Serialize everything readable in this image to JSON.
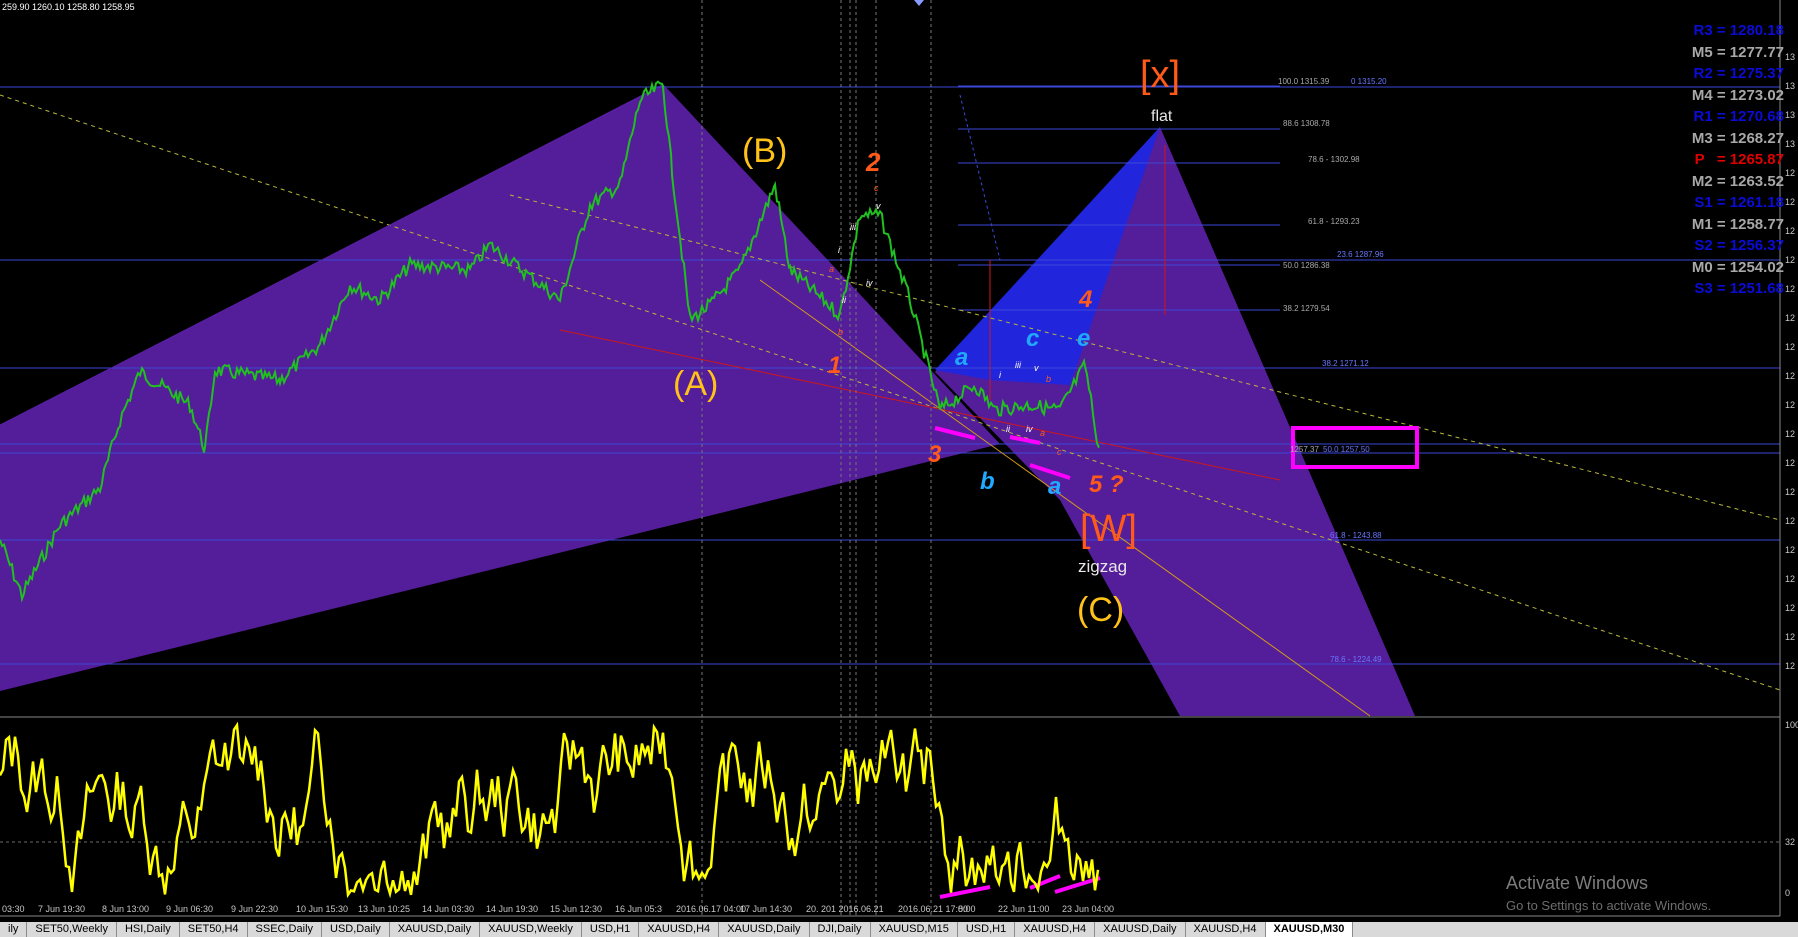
{
  "header": {
    "ohlc": "259.90 1260.10 1258.80 1258.95"
  },
  "pivots": [
    {
      "label": "R3 = 1280.18",
      "color": "#0b0bd6"
    },
    {
      "label": "M5 = 1277.77",
      "color": "#a8a8a8"
    },
    {
      "label": "R2 = 1275.37",
      "color": "#0b0bd6"
    },
    {
      "label": "M4 = 1273.02",
      "color": "#a8a8a8"
    },
    {
      "label": "R1 = 1270.68",
      "color": "#0b0bd6"
    },
    {
      "label": "M3 = 1268.27",
      "color": "#a8a8a8"
    },
    {
      "label": "P   = 1265.87",
      "color": "#e00000"
    },
    {
      "label": "M2 = 1263.52",
      "color": "#a8a8a8"
    },
    {
      "label": "S1 = 1261.18",
      "color": "#0b0bd6"
    },
    {
      "label": "M1 = 1258.77",
      "color": "#a8a8a8"
    },
    {
      "label": "S2 = 1256.37",
      "color": "#0b0bd6"
    },
    {
      "label": "M0 = 1254.02",
      "color": "#a8a8a8"
    },
    {
      "label": "S3 = 1251.68",
      "color": "#0b0bd6"
    }
  ],
  "fib_labels": [
    "100.0 1315.39",
    "0 1315.20",
    "88.6 1308.78",
    "78.6 - 1302.98",
    "61.8 - 1293.23",
    "23.6 1287.96",
    "50.0 1286.38",
    "38.2 1279.54",
    "38.2 1271.12",
    "1257.37",
    "50.0 1257.50",
    "61.8 - 1243.88",
    "78.6 - 1224.49"
  ],
  "wave_labels": {
    "B": "(B)",
    "A": "(A)",
    "C": "(C)",
    "X": "[x]",
    "W": "[W]",
    "flat": "flat",
    "zigzag": "zigzag",
    "n1": "1",
    "n2": "2",
    "n3": "3",
    "n4": "4",
    "n5q": "5 ?",
    "a1": "a",
    "b1": "b",
    "c1": "c",
    "e1": "e",
    "a2": "a",
    "small_iii": "iii",
    "small_i": "i",
    "small_ii": "ii",
    "small_iv": "iv",
    "small_v": "v",
    "small_a": "a",
    "small_b": "b",
    "small_c": "c"
  },
  "time_labels": [
    "03:30",
    "7 Jun 19:30",
    "8 Jun 13:00",
    "9 Jun 06:30",
    "9 Jun 22:30",
    "10 Jun 15:30",
    "13 Jun 10:25",
    "14 Jun 03:30",
    "14 Jun 19:30",
    "15 Jun 12:30",
    "16 Jun 05:3",
    "2016.06.17 04:00",
    "17 Jun 14:30",
    "20. 201 2016.06.21",
    "2016.06.21 17:00",
    "8:00",
    "22 Jun 11:00",
    "23 Jun 04:00"
  ],
  "right_axis_labels": [
    "13",
    "13",
    "13",
    "13",
    "12",
    "12",
    "12",
    "12",
    "12",
    "12",
    "12",
    "12",
    "12",
    "12",
    "12",
    "12",
    "12",
    "12",
    "12",
    "12",
    "12",
    "12"
  ],
  "osc_axis": [
    "100",
    "32",
    "0"
  ],
  "tabs": [
    "ily",
    "SET50,Weekly",
    "HSI,Daily",
    "SET50,H4",
    "SSEC,Daily",
    "USD,Daily",
    "XAUUSD,Daily",
    "XAUUSD,Weekly",
    "USD,H1",
    "XAUUSD,H4",
    "XAUUSD,Daily",
    "DJI,Daily",
    "XAUUSD,M15",
    "USD,H1",
    "XAUUSD,H4",
    "XAUUSD,Daily",
    "XAUUSD,H4",
    "XAUUSD,M30"
  ],
  "active_tab": "XAUUSD,M30",
  "watermark": {
    "title": "Activate Windows",
    "sub": "Go to Settings to activate Windows."
  },
  "colors": {
    "purple": "#5b1fa6",
    "blue": "#1f27e0",
    "candle": "#20c020",
    "fib": "#3b48d8",
    "magenta": "#ff00ff",
    "orange": "#ff5a1a",
    "gold": "#ffc218",
    "cyan": "#21a8ff",
    "osc": "#ffff00"
  }
}
